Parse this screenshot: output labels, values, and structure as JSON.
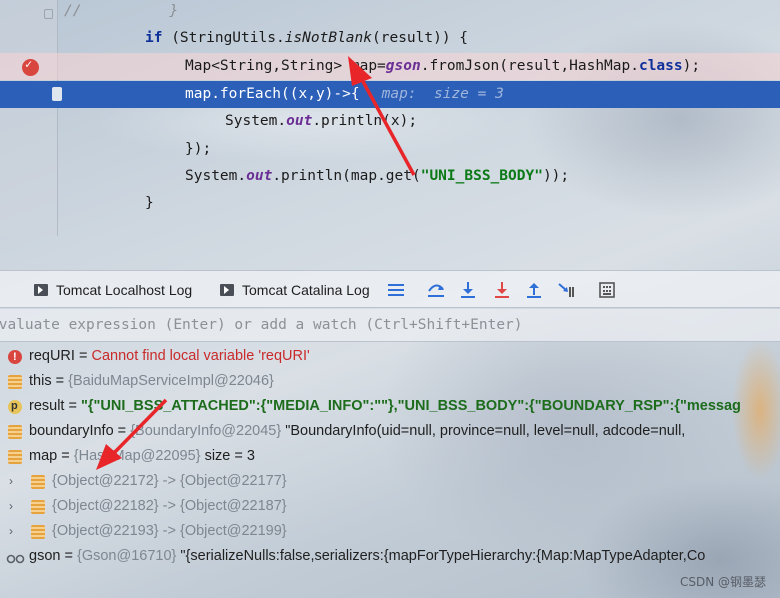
{
  "editor": {
    "lines": [
      {
        "comment": "//",
        "closing": "}"
      },
      {
        "if_kw": "if",
        "rest": " (StringUtils.",
        "method": "isNotBlank",
        "tail": "(result)) {"
      },
      {
        "type_decl": "Map<String,String> map=",
        "field": "gson",
        "call": ".fromJson(result,HashMap.",
        "kw": "class",
        "end": ");"
      },
      {
        "code": "map.forEach((x,y)->{",
        "hint": "map:  size = 3"
      },
      {
        "pre": "System.",
        "field": "out",
        "post": ".println(x);"
      },
      {
        "code": "});"
      },
      {
        "pre": "System.",
        "field": "out",
        "post": ".println(map.get(",
        "str": "\"UNI_BSS_BODY\"",
        "end": "));"
      },
      {
        "code": "}"
      }
    ]
  },
  "debug": {
    "tabs": [
      {
        "label": "Tomcat Localhost Log"
      },
      {
        "label": "Tomcat Catalina Log"
      }
    ],
    "tools": [
      "menu-icon",
      "step-over-icon",
      "step-into-icon",
      "force-step-into-icon",
      "step-out-icon",
      "run-to-cursor-icon",
      "evaluate-icon"
    ],
    "eval_placeholder": "Evaluate expression (Enter) or add a watch (Ctrl+Shift+Enter)",
    "variables": [
      {
        "name": "reqURI",
        "eq": " = ",
        "error": "Cannot find local variable 'reqURI'"
      },
      {
        "name": "this",
        "eq": " = ",
        "ref": "{BaiduMapServiceImpl@22046}"
      },
      {
        "name": "result",
        "eq": " = ",
        "value": "\"{\"UNI_BSS_ATTACHED\":{\"MEDIA_INFO\":\"\"},\"UNI_BSS_BODY\":{\"BOUNDARY_RSP\":{\"messag"
      },
      {
        "name": "boundaryInfo",
        "eq": " = ",
        "ref": "{BoundaryInfo@22045}",
        "plain": " \"BoundaryInfo(uid=null, province=null, level=null, adcode=null,"
      },
      {
        "name": "map",
        "eq": " = ",
        "ref": "{HashMap@22095}",
        "plain": "  size = 3"
      },
      {
        "ref": "{Object@22172}",
        "arrow": "  ->  ",
        "ref2": "{Object@22177}"
      },
      {
        "ref": "{Object@22182}",
        "arrow": "  ->  ",
        "ref2": "{Object@22187}"
      },
      {
        "ref": "{Object@22193}",
        "arrow": "  ->  ",
        "ref2": "{Object@22199}"
      },
      {
        "name": "gson",
        "eq": " = ",
        "ref": "{Gson@16710}",
        "plain": " \"{serializeNulls:false,serializers:{mapForTypeHierarchy:{Map:MapTypeAdapter,Co"
      }
    ]
  },
  "watermark": "CSDN @钢墨瑟",
  "colors": {
    "exec_line": "#2c5fb8",
    "arrow": "#e8262a",
    "error": "#c92a2a",
    "string_value": "#1c6c1c"
  }
}
